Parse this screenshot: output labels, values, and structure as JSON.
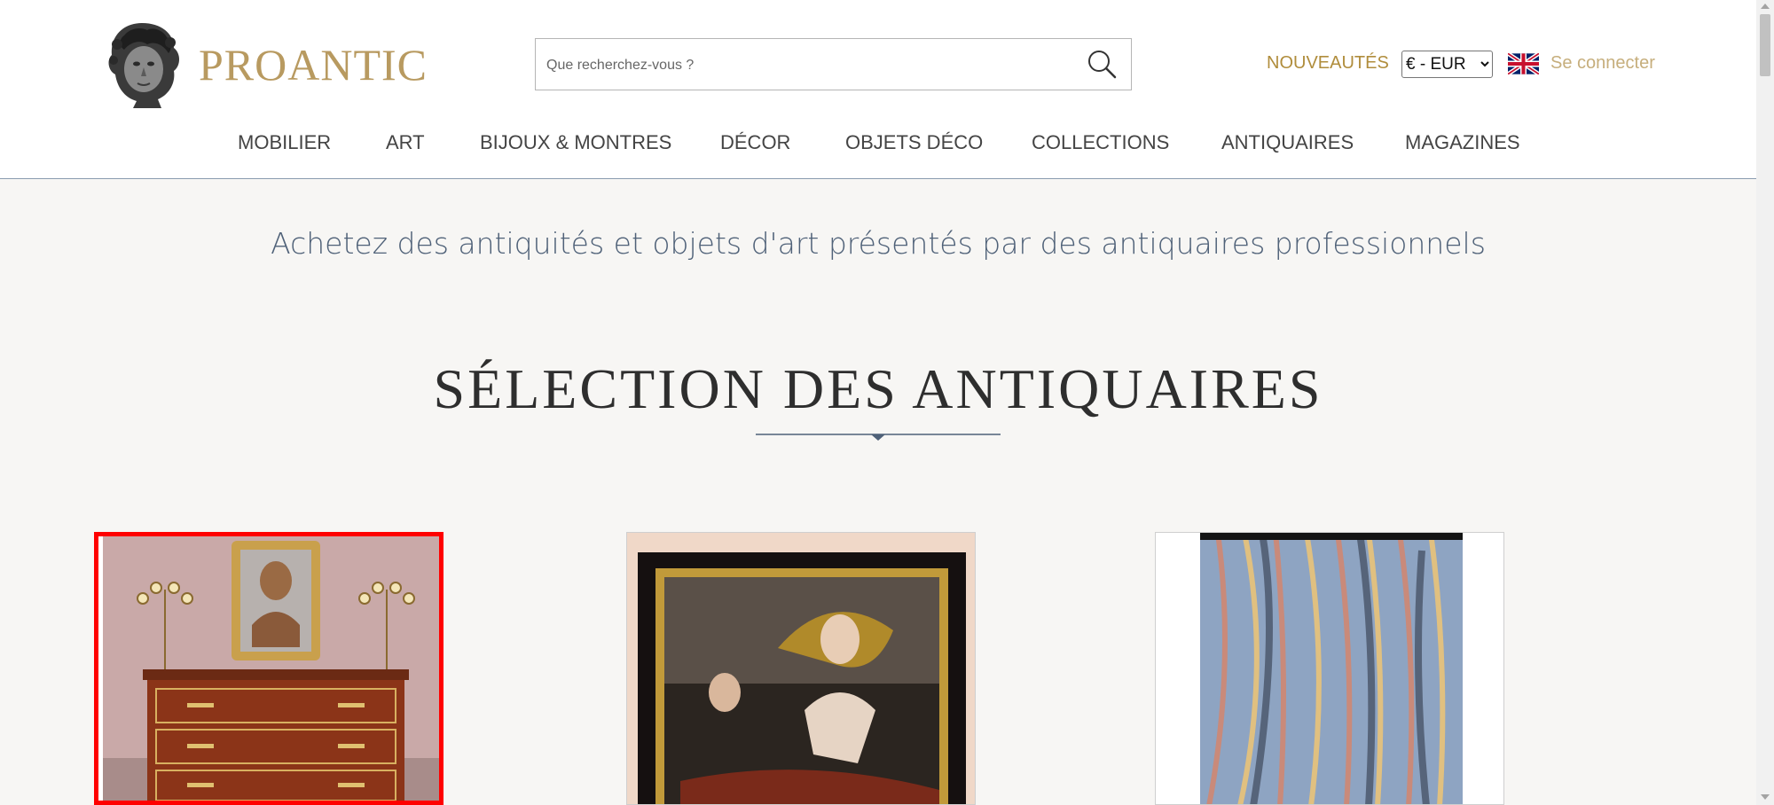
{
  "header": {
    "logo_text": "PROANTIC",
    "search": {
      "placeholder": "Que recherchez-vous ?",
      "value": ""
    },
    "nouveautes_label": "NOUVEAUTÉS",
    "currency": {
      "selected": "€ - EUR",
      "options": [
        "€ - EUR"
      ]
    },
    "language_flag": "uk-flag-icon",
    "login_label": "Se connecter"
  },
  "nav": {
    "items": [
      {
        "label": "MOBILIER"
      },
      {
        "label": "ART"
      },
      {
        "label": "BIJOUX & MONTRES"
      },
      {
        "label": "DÉCOR"
      },
      {
        "label": "OBJETS DÉCO"
      },
      {
        "label": "COLLECTIONS"
      },
      {
        "label": "ANTIQUAIRES"
      },
      {
        "label": "MAGAZINES"
      }
    ]
  },
  "main": {
    "tagline": "Achetez des antiquités et objets d'art présentés par des antiquaires professionnels",
    "section_title": "SÉLECTION DES ANTIQUAIRES",
    "products": [
      {
        "image": "commode-with-bust-and-candelabra-image",
        "selected": true
      },
      {
        "image": "framed-mythological-painting-image",
        "selected": false
      },
      {
        "image": "striped-silk-fabric-image",
        "selected": false
      }
    ]
  },
  "colors": {
    "brand_gold": "#b89a60",
    "nouveautes": "#b08d3c",
    "login": "#c6ae7c",
    "tagline": "#4f6178",
    "background": "#f7f6f4",
    "selection_outline": "#ff0000"
  }
}
